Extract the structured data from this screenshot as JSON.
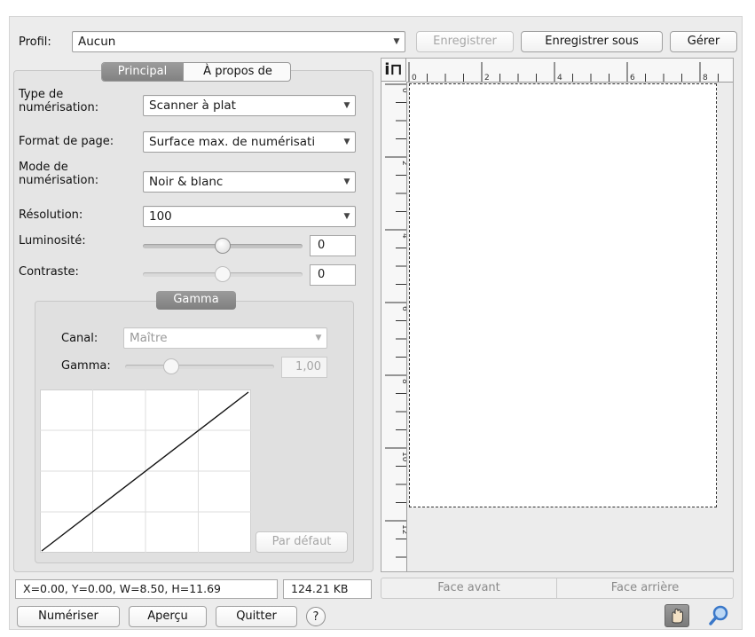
{
  "profile": {
    "label": "Profil:",
    "value": "Aucun",
    "save_label": "Enregistrer",
    "save_as_label": "Enregistrer sous",
    "manage_label": "Gérer"
  },
  "tabs": {
    "main": "Principal",
    "about": "À propos de"
  },
  "settings": {
    "scan_type_label": "Type de numérisation:",
    "scan_type_value": "Scanner à plat",
    "page_size_label": "Format de page:",
    "page_size_value": "Surface max. de numérisati",
    "scan_mode_label": "Mode de numérisation:",
    "scan_mode_value": "Noir & blanc",
    "resolution_label": "Résolution:",
    "resolution_value": "100",
    "brightness_label": "Luminosité:",
    "brightness_value": "0",
    "contrast_label": "Contraste:",
    "contrast_value": "0"
  },
  "gamma": {
    "title": "Gamma",
    "channel_label": "Canal:",
    "channel_value": "Maître",
    "gamma_label": "Gamma:",
    "gamma_value": "1,00",
    "default_label": "Par défaut"
  },
  "ruler": {
    "h_labels": [
      "0",
      "2",
      "4",
      "6",
      "8"
    ],
    "v_labels": [
      "0",
      "2",
      "4",
      "6",
      "8",
      "10",
      "12"
    ]
  },
  "status": {
    "coords": "X=0.00, Y=0.00, W=8.50, H=11.69",
    "size": "124.21 KB"
  },
  "face": {
    "front": "Face avant",
    "back": "Face arrière"
  },
  "buttons": {
    "scan": "Numériser",
    "preview": "Aperçu",
    "quit": "Quitter",
    "help": "?"
  },
  "icons": {
    "ruler_corner": "ruler-unit-icon",
    "hand": "hand-tool-icon",
    "zoom": "zoom-icon"
  },
  "colors": {
    "selected_tab": "#8c8c8c",
    "panel": "#e5e5e5",
    "dialog": "#ececec",
    "zoom_blue": "#3a78c9"
  }
}
